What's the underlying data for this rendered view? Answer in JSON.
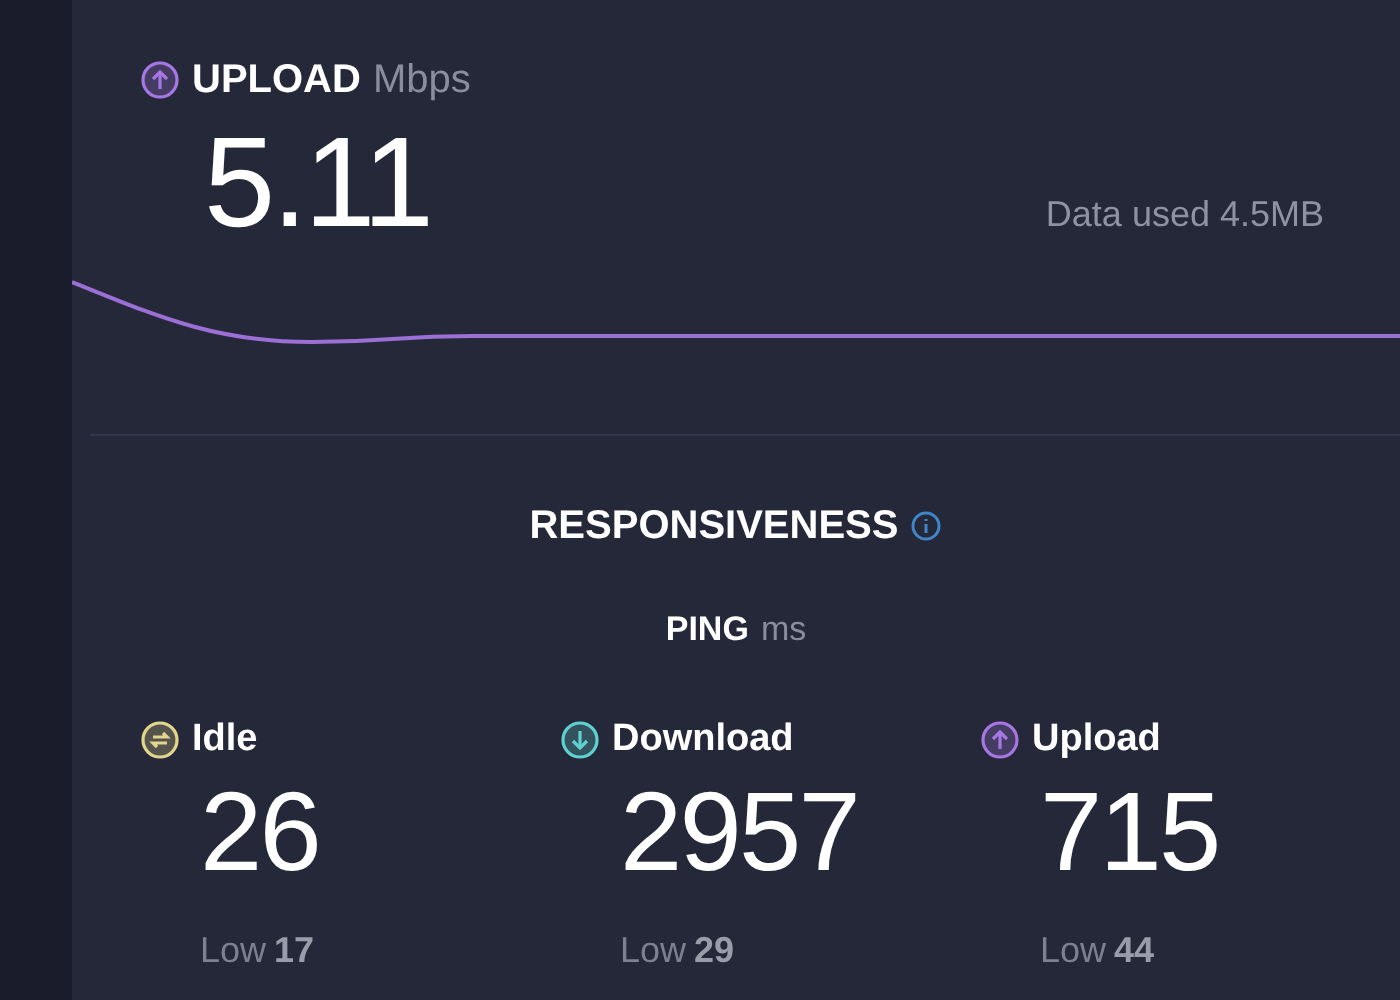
{
  "upload": {
    "label": "UPLOAD",
    "unit": "Mbps",
    "value": "5.11",
    "data_used": "Data used 4.5MB"
  },
  "responsiveness": {
    "title": "RESPONSIVENESS",
    "ping_label": "PING",
    "ping_unit": "ms",
    "metrics": [
      {
        "kind": "idle",
        "color": "#e3d58a",
        "label": "Idle",
        "value": "26",
        "low_label": "Low",
        "low_value": "17"
      },
      {
        "kind": "download",
        "color": "#5fd1d0",
        "label": "Download",
        "value": "2957",
        "low_label": "Low",
        "low_value": "29"
      },
      {
        "kind": "upload",
        "color": "#a777e3",
        "label": "Upload",
        "value": "715",
        "low_label": "Low",
        "low_value": "44"
      }
    ]
  }
}
